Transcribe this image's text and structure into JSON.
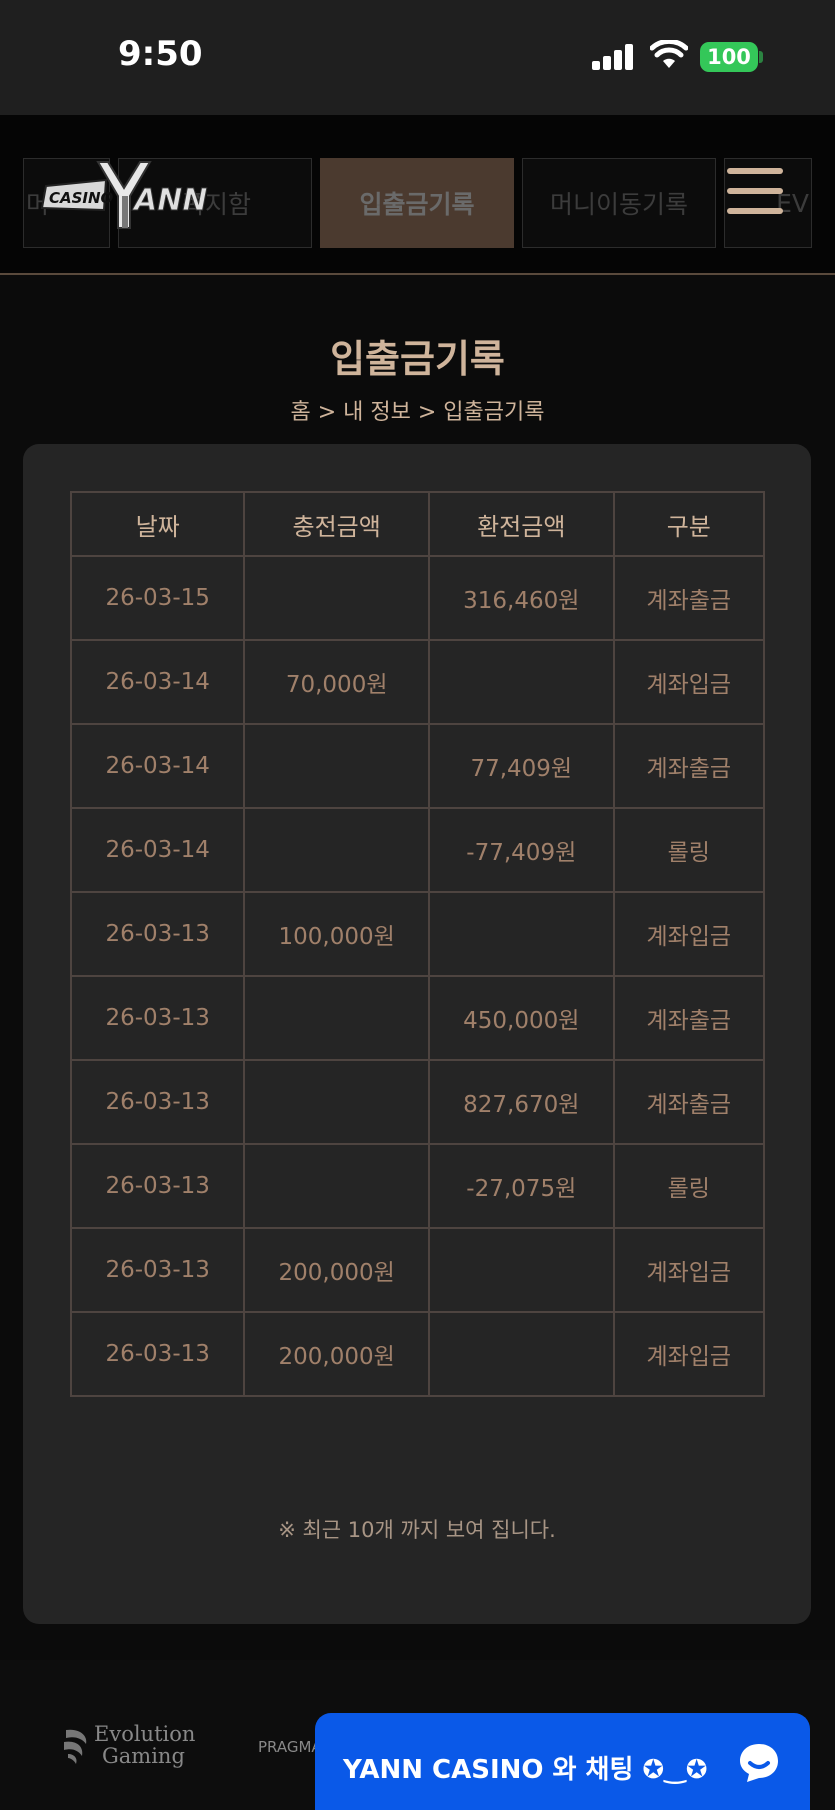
{
  "status_bar": {
    "time": "9:50",
    "battery": "100"
  },
  "header": {
    "logo_text": "CASINO YANN",
    "tabs": [
      {
        "label": "머"
      },
      {
        "label": "쪽지함"
      },
      {
        "label": "입출금기록",
        "active": true
      },
      {
        "label": "머니이동기록"
      },
      {
        "label": "EV"
      }
    ]
  },
  "page": {
    "title": "입출금기록",
    "breadcrumb": "홈 > 내 정보 > 입출금기록"
  },
  "table": {
    "headers": {
      "date": "날짜",
      "charge": "충전금액",
      "exchange": "환전금액",
      "type": "구분"
    },
    "rows": [
      {
        "date": "26-03-15",
        "charge": "",
        "exchange": "316,460원",
        "type": "계좌출금"
      },
      {
        "date": "26-03-14",
        "charge": "70,000원",
        "exchange": "",
        "type": "계좌입금"
      },
      {
        "date": "26-03-14",
        "charge": "",
        "exchange": "77,409원",
        "type": "계좌출금"
      },
      {
        "date": "26-03-14",
        "charge": "",
        "exchange": "-77,409원",
        "type": "롤링"
      },
      {
        "date": "26-03-13",
        "charge": "100,000원",
        "exchange": "",
        "type": "계좌입금"
      },
      {
        "date": "26-03-13",
        "charge": "",
        "exchange": "450,000원",
        "type": "계좌출금"
      },
      {
        "date": "26-03-13",
        "charge": "",
        "exchange": "827,670원",
        "type": "계좌출금"
      },
      {
        "date": "26-03-13",
        "charge": "",
        "exchange": "-27,075원",
        "type": "롤링"
      },
      {
        "date": "26-03-13",
        "charge": "200,000원",
        "exchange": "",
        "type": "계좌입금"
      },
      {
        "date": "26-03-13",
        "charge": "200,000원",
        "exchange": "",
        "type": "계좌입금"
      }
    ]
  },
  "note": "※ 최근 10개 까지 보여 집니다.",
  "footer": {
    "evolution_line1": "Evolution",
    "evolution_line2": "Gaming",
    "pragmatic": "PRAGMA"
  },
  "chat": {
    "label": "YANN CASINO 와 채팅 ✪‿✪"
  },
  "colors": {
    "accent": "#cfb49b",
    "active_tab": "#4b3a2f",
    "chat_blue": "#0a59e8",
    "battery_green": "#34c759"
  }
}
